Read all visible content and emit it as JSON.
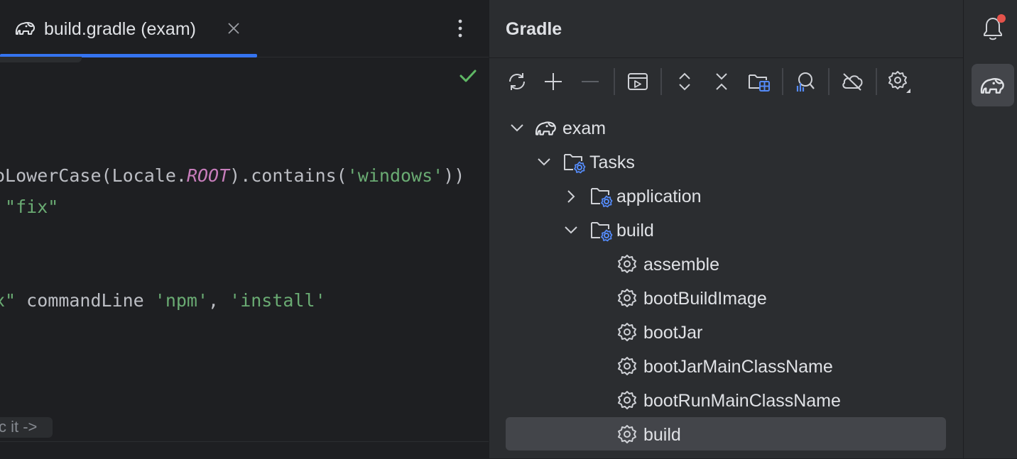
{
  "editor": {
    "tab": {
      "title": "build.gradle (exam)",
      "icon": "gradle-elephant-icon"
    },
    "inspection_status_icon": "check-icon",
    "code_lines": [
      {
        "segments": [
          {
            "text": "oLowerCase(Locale.",
            "kind": "plain"
          },
          {
            "text": "ROOT",
            "kind": "const"
          },
          {
            "text": ").contains(",
            "kind": "plain"
          },
          {
            "text": "'windows'",
            "kind": "string"
          },
          {
            "text": "))",
            "kind": "plain"
          }
        ]
      },
      {
        "segments": [
          {
            "text": " \"fix\"",
            "kind": "string"
          }
        ]
      },
      {
        "segments": [
          {
            "text": "x\"",
            "kind": "string"
          },
          {
            "text": " commandLine ",
            "kind": "plain"
          },
          {
            "text": "'npm'",
            "kind": "string"
          },
          {
            "text": ", ",
            "kind": "plain"
          },
          {
            "text": "'install'",
            "kind": "string"
          }
        ]
      }
    ],
    "inlay_hint": "c it ->",
    "colors": {
      "string": "#6aab73",
      "const": "#c77dbb",
      "accent": "#3574f0"
    }
  },
  "gradle": {
    "title": "Gradle",
    "toolbar": [
      "reload-icon",
      "add-icon",
      "remove-icon",
      "run-task-icon",
      "expand-all-icon",
      "collapse-all-icon",
      "group-modules-icon",
      "analyze-dependencies-icon",
      "offline-mode-icon",
      "settings-icon"
    ],
    "tree": {
      "project": "exam",
      "tasks_label": "Tasks",
      "groups": [
        {
          "label": "application",
          "expanded": false
        },
        {
          "label": "build",
          "expanded": true
        }
      ],
      "build_tasks": [
        "assemble",
        "bootBuildImage",
        "bootJar",
        "bootJarMainClassName",
        "bootRunMainClassName",
        "build"
      ],
      "selected_task": "build"
    }
  },
  "tool_strip": {
    "items": [
      "notifications-icon",
      "gradle-tool-window-icon"
    ],
    "notification_badge": true
  }
}
